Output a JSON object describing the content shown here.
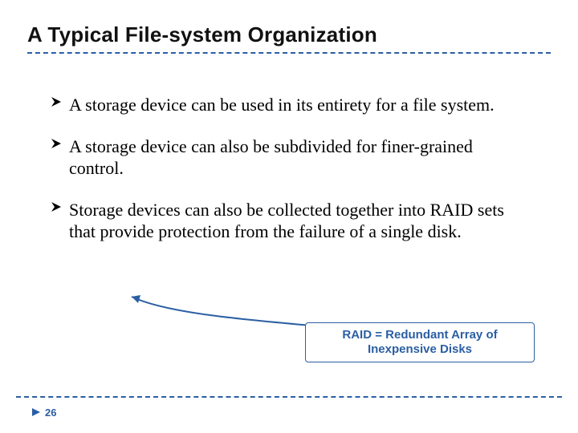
{
  "title": "A Typical File-system Organization",
  "bullets": [
    "A storage device can be used in its entirety for a file system.",
    "A storage device can also be subdivided for finer-grained control.",
    "Storage devices can also be collected together into RAID sets that provide protection from the failure of a single disk."
  ],
  "callout": "RAID = Redundant Array of Inexpensive Disks",
  "page_number": "26"
}
